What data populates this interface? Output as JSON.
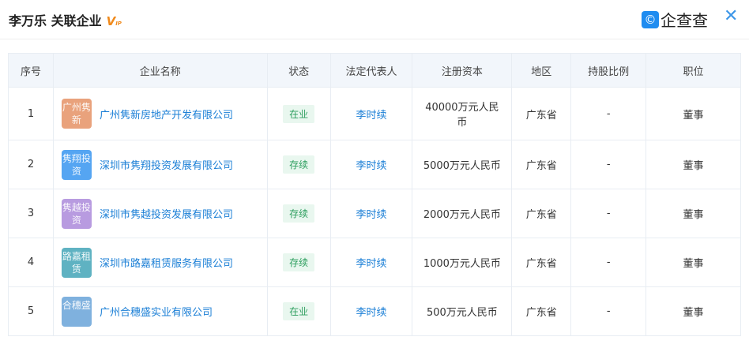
{
  "header": {
    "title": "李万乐 关联企业",
    "vip": "V",
    "vip_sub": "IP",
    "brand": "企查查",
    "brand_icon": "©",
    "close": "✕"
  },
  "columns": [
    "序号",
    "企业名称",
    "状态",
    "法定代表人",
    "注册资本",
    "地区",
    "持股比例",
    "职位"
  ],
  "rows": [
    {
      "no": "1",
      "logo": "广州隽新",
      "logo_color": "#e9a27c",
      "name": "广州隽新房地产开发有限公司",
      "status": "在业",
      "rep": "李时续",
      "capital": "40000万元人民币",
      "region": "广东省",
      "share": "-",
      "position": "董事"
    },
    {
      "no": "2",
      "logo": "隽翔投资",
      "logo_color": "#55a5f2",
      "name": "深圳市隽翔投资发展有限公司",
      "status": "存续",
      "rep": "李时续",
      "capital": "5000万元人民币",
      "region": "广东省",
      "share": "-",
      "position": "董事"
    },
    {
      "no": "3",
      "logo": "隽越投资",
      "logo_color": "#b89be0",
      "name": "深圳市隽越投资发展有限公司",
      "status": "存续",
      "rep": "李时续",
      "capital": "2000万元人民币",
      "region": "广东省",
      "share": "-",
      "position": "董事"
    },
    {
      "no": "4",
      "logo": "路嘉租赁",
      "logo_color": "#5fb2c2",
      "name": "深圳市路嘉租赁服务有限公司",
      "status": "存续",
      "rep": "李时续",
      "capital": "1000万元人民币",
      "region": "广东省",
      "share": "-",
      "position": "董事"
    },
    {
      "no": "5",
      "logo": "合穗盛",
      "logo_color": "#7fb1de",
      "name": "广州合穗盛实业有限公司",
      "status": "在业",
      "rep": "李时续",
      "capital": "500万元人民币",
      "region": "广东省",
      "share": "-",
      "position": "董事"
    }
  ]
}
